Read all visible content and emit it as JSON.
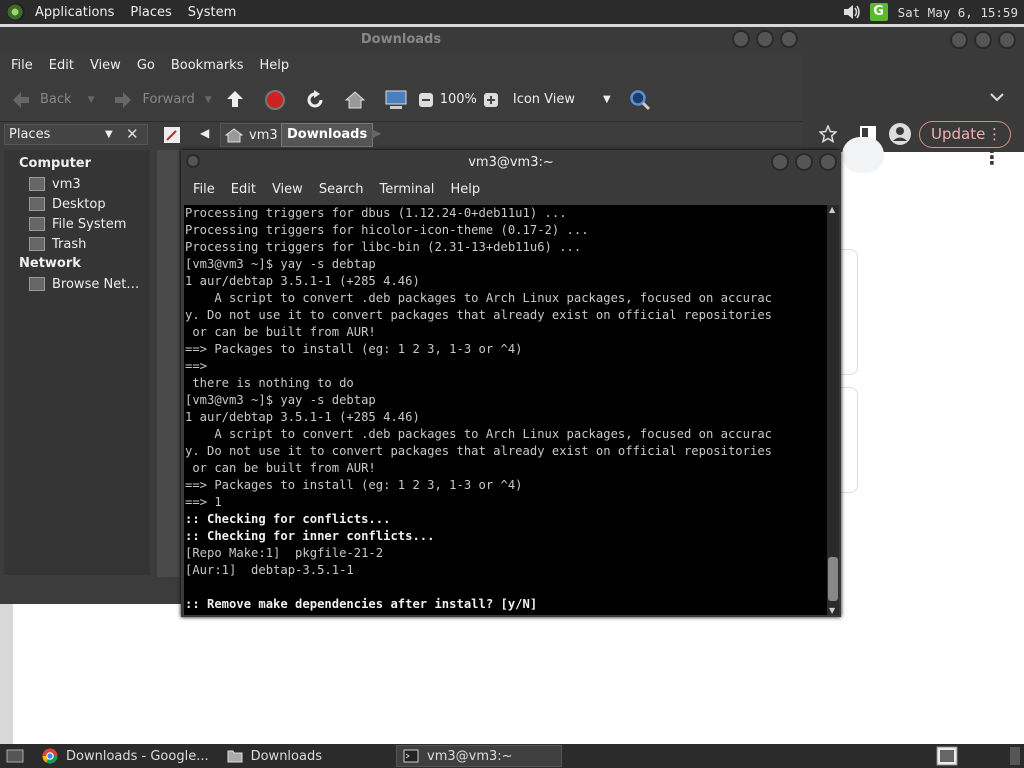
{
  "top_panel": {
    "menus": [
      "Applications",
      "Places",
      "System"
    ],
    "clock": "Sat May  6, 15:59",
    "tray_g": "G"
  },
  "browser": {
    "update_label": "Update"
  },
  "file_manager": {
    "title": "Downloads",
    "menus": [
      "File",
      "Edit",
      "View",
      "Go",
      "Bookmarks",
      "Help"
    ],
    "toolbar": {
      "back": "Back",
      "forward": "Forward",
      "zoom": "100%",
      "view_mode": "Icon View"
    },
    "sidebar_selector": "Places",
    "path": [
      "vm3",
      "Downloads"
    ],
    "sidebar": {
      "computer_heading": "Computer",
      "computer_items": [
        "vm3",
        "Desktop",
        "File System",
        "Trash"
      ],
      "network_heading": "Network",
      "network_items": [
        "Browse Net…"
      ]
    }
  },
  "terminal": {
    "title": "vm3@vm3:~",
    "menus": [
      "File",
      "Edit",
      "View",
      "Search",
      "Terminal",
      "Help"
    ],
    "lines": [
      {
        "t": "Processing triggers for dbus (1.12.24-0+deb11u1) ...",
        "b": false
      },
      {
        "t": "Processing triggers for hicolor-icon-theme (0.17-2) ...",
        "b": false
      },
      {
        "t": "Processing triggers for libc-bin (2.31-13+deb11u6) ...",
        "b": false
      },
      {
        "t": "[vm3@vm3 ~]$ yay -s debtap",
        "b": false
      },
      {
        "t": "1 aur/debtap 3.5.1-1 (+285 4.46)",
        "b": false
      },
      {
        "t": "    A script to convert .deb packages to Arch Linux packages, focused on accurac",
        "b": false
      },
      {
        "t": "y. Do not use it to convert packages that already exist on official repositories",
        "b": false
      },
      {
        "t": " or can be built from AUR!",
        "b": false
      },
      {
        "t": "==> Packages to install (eg: 1 2 3, 1-3 or ^4)",
        "b": false
      },
      {
        "t": "==>",
        "b": false
      },
      {
        "t": " there is nothing to do",
        "b": false
      },
      {
        "t": "[vm3@vm3 ~]$ yay -s debtap",
        "b": false
      },
      {
        "t": "1 aur/debtap 3.5.1-1 (+285 4.46)",
        "b": false
      },
      {
        "t": "    A script to convert .deb packages to Arch Linux packages, focused on accurac",
        "b": false
      },
      {
        "t": "y. Do not use it to convert packages that already exist on official repositories",
        "b": false
      },
      {
        "t": " or can be built from AUR!",
        "b": false
      },
      {
        "t": "==> Packages to install (eg: 1 2 3, 1-3 or ^4)",
        "b": false
      },
      {
        "t": "==> 1",
        "b": false
      },
      {
        "t": ":: Checking for conflicts...",
        "b": true
      },
      {
        "t": ":: Checking for inner conflicts...",
        "b": true
      },
      {
        "t": "[Repo Make:1]  pkgfile-21-2",
        "b": false
      },
      {
        "t": "[Aur:1]  debtap-3.5.1-1",
        "b": false
      },
      {
        "t": "",
        "b": false
      },
      {
        "t": ":: Remove make dependencies after install? [y/N]",
        "b": true
      }
    ]
  },
  "taskbar": {
    "tasks": [
      "Downloads - Google...",
      "Downloads",
      "vm3@vm3:~"
    ]
  }
}
